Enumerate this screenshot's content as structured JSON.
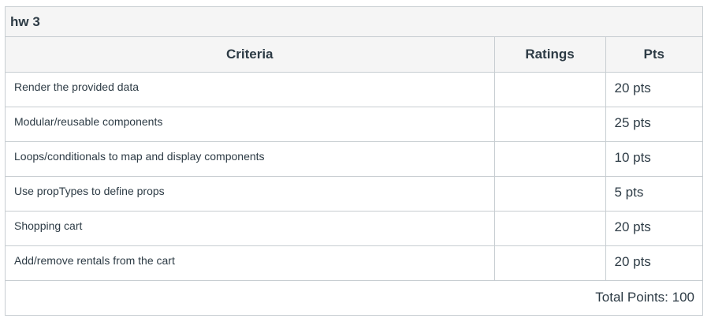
{
  "rubric": {
    "title": "hw 3",
    "headers": {
      "criteria": "Criteria",
      "ratings": "Ratings",
      "pts": "Pts"
    },
    "rows": [
      {
        "criterion": "Render the provided data",
        "rating": "",
        "pts": "20 pts"
      },
      {
        "criterion": "Modular/reusable components",
        "rating": "",
        "pts": "25 pts"
      },
      {
        "criterion": "Loops/conditionals to map and display components",
        "rating": "",
        "pts": "10 pts"
      },
      {
        "criterion": "Use propTypes to define props",
        "rating": "",
        "pts": "5 pts"
      },
      {
        "criterion": "Shopping cart",
        "rating": "",
        "pts": "20 pts"
      },
      {
        "criterion": "Add/remove rentals from the cart",
        "rating": "",
        "pts": "20 pts"
      }
    ],
    "total": "Total Points: 100"
  }
}
